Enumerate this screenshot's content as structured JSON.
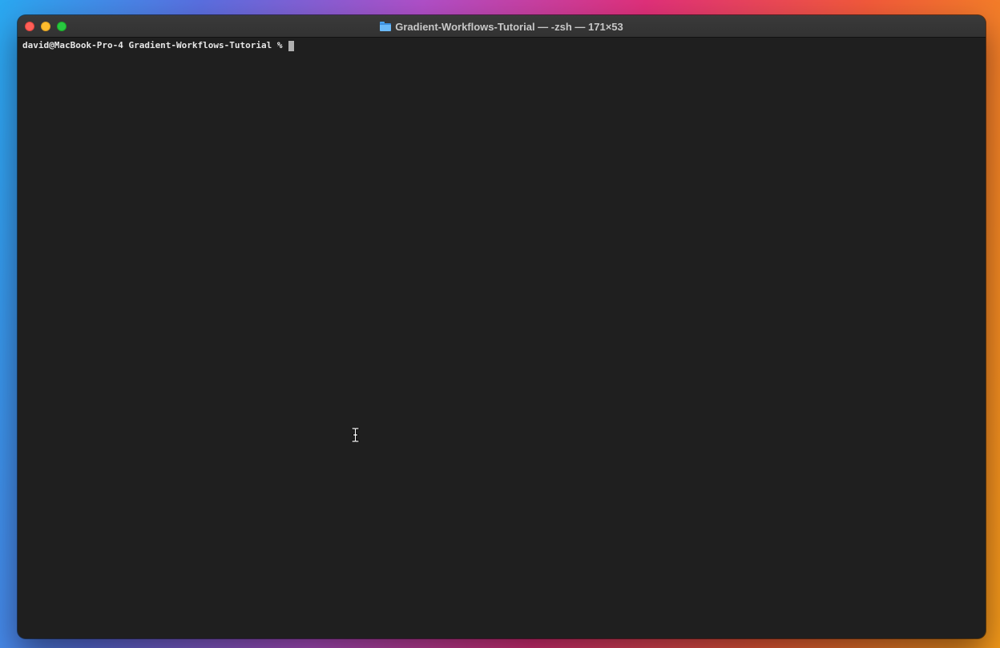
{
  "window": {
    "title": "Gradient-Workflows-Tutorial — -zsh — 171×53",
    "title_icon": "folder-icon"
  },
  "terminal": {
    "prompt": "david@MacBook-Pro-4 Gradient-Workflows-Tutorial % ",
    "input": ""
  },
  "colors": {
    "terminal_background": "#1f1f1f",
    "terminal_text": "#e6e6e6",
    "close": "#ff5f57",
    "minimize": "#febc2e",
    "zoom": "#28c840"
  },
  "mouse_cursor": "ibeam-cursor-icon"
}
